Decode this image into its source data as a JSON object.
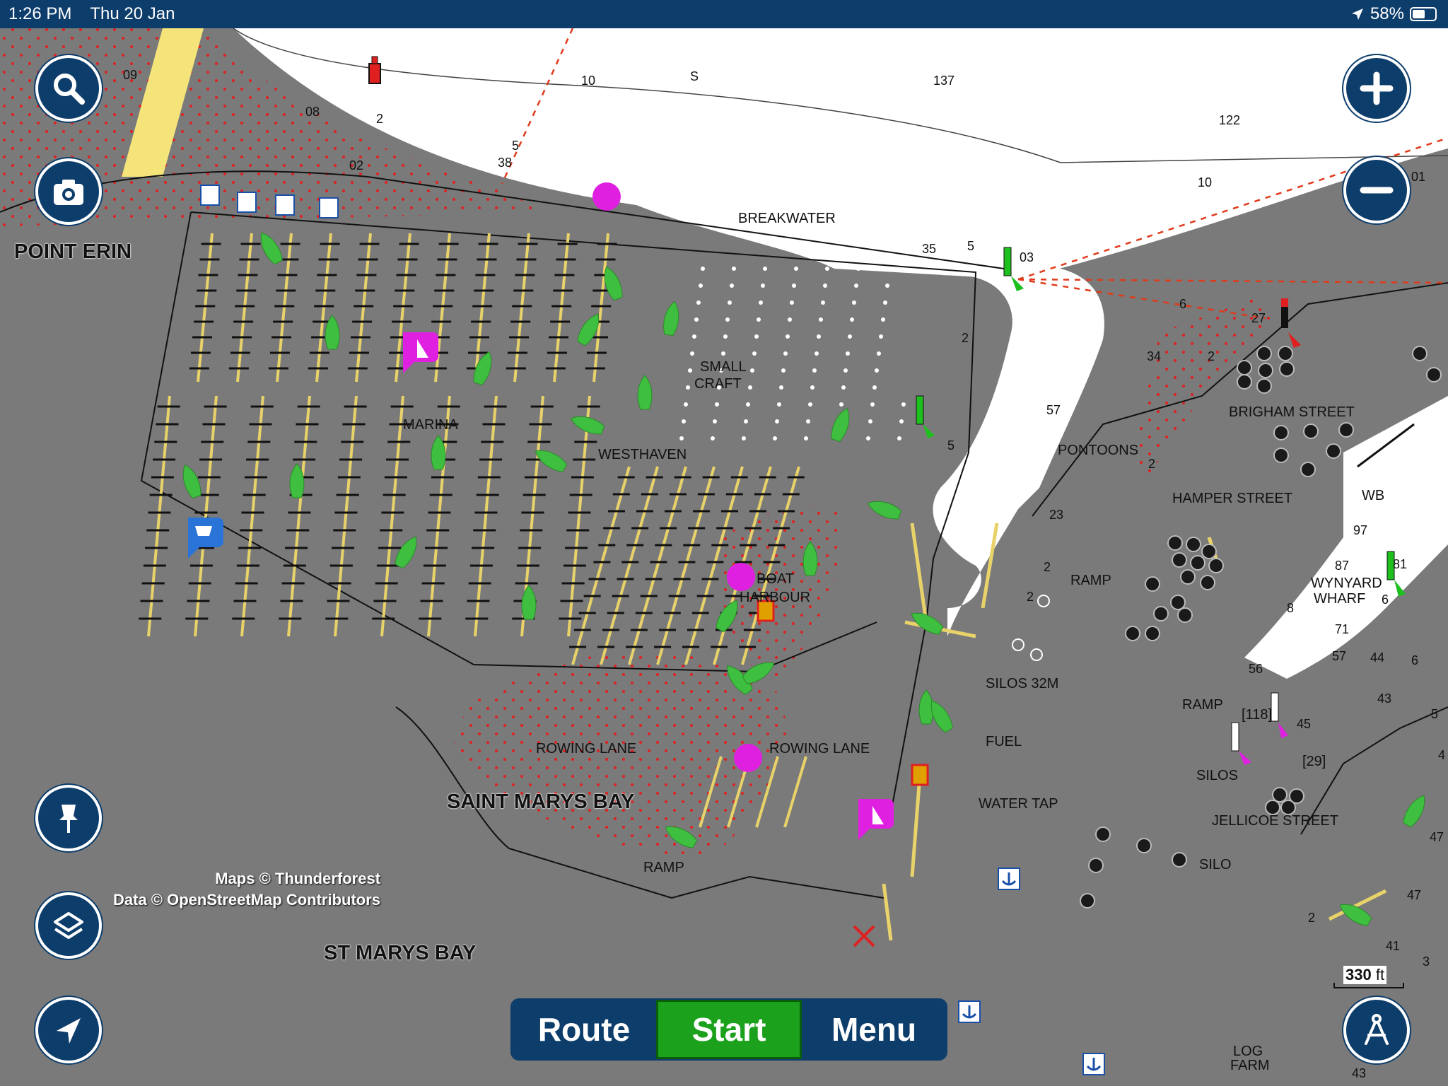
{
  "status": {
    "time": "1:26 PM",
    "date": "Thu 20 Jan",
    "battery": "58%",
    "battery_level": 0.58
  },
  "places": {
    "point_erin": "POINT ERIN",
    "breakwater": "BREAKWATER",
    "small_craft_1": "SMALL",
    "small_craft_2": "CRAFT",
    "marina": "MARINA",
    "westhaven": "WESTHAVEN",
    "boat_harbour_1": "BOAT",
    "boat_harbour_2": "HARBOUR",
    "pontoons": "PONTOONS",
    "brigham_street": "BRIGHAM STREET",
    "hamper_street": "HAMPER STREET",
    "wb": "WB",
    "ramp_1": "RAMP",
    "wynyard_wharf_1": "WYNYARD",
    "wynyard_wharf_2": "WHARF",
    "silos_32m": "SILOS 32M",
    "fuel": "FUEL",
    "water_tap": "WATER TAP",
    "ramp_2": "RAMP",
    "silos": "SILOS",
    "silo": "SILO",
    "jellicoe_street": "JELLICOE STREET",
    "rowing_lane_1": "ROWING LANE",
    "rowing_lane_2": "ROWING LANE",
    "saint_marys_bay": "SAINT MARYS BAY",
    "st_marys_bay": "ST MARYS BAY",
    "ramp_3": "RAMP",
    "log_farm_1": "LOG",
    "log_farm_2": "FARM",
    "code_118": "[118]",
    "code_29": "[29]"
  },
  "depths": [
    "09",
    "08",
    "2",
    "02",
    "38",
    "5",
    "10",
    "S",
    "137",
    "122",
    "10",
    "01",
    "35",
    "5",
    "03",
    "6",
    "27",
    "34",
    "2",
    "57",
    "2",
    "5",
    "2",
    "23",
    "2",
    "2",
    "97",
    "81",
    "87",
    "6",
    "8",
    "71",
    "57",
    "44",
    "6",
    "56",
    "45",
    "43",
    "5",
    "4",
    "47",
    "47",
    "41",
    "2",
    "3",
    "43"
  ],
  "attribution": {
    "line1": "Maps © Thunderforest",
    "line2": "Data © OpenStreetMap Contributors"
  },
  "scale": {
    "value": "330",
    "unit": "ft"
  },
  "nav": {
    "route": "Route",
    "start": "Start",
    "menu": "Menu"
  },
  "icons": [
    "search-icon",
    "camera-icon",
    "pin-icon",
    "layers-icon",
    "locate-arrow-icon",
    "zoom-in-icon",
    "zoom-out-icon",
    "compass-icon"
  ]
}
